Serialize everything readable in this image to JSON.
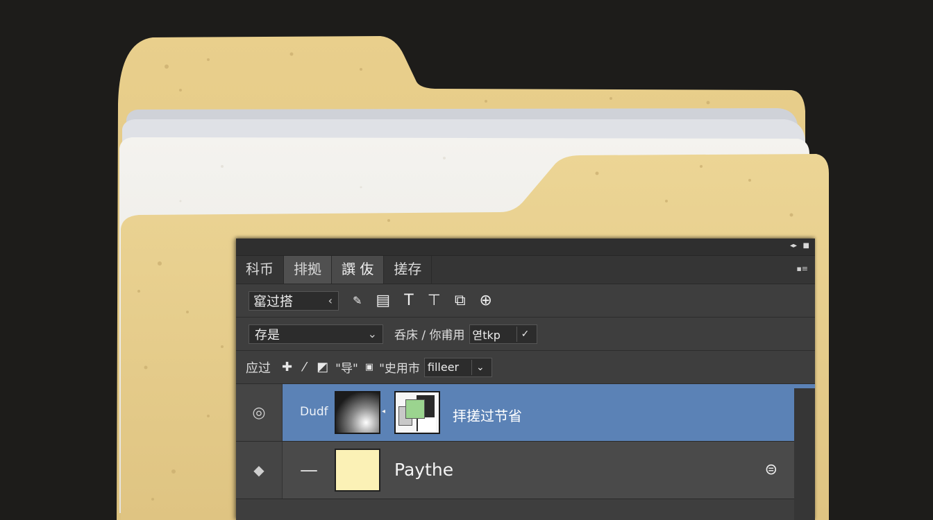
{
  "panel": {
    "titlebar": {
      "collapse_icon": "double-arrow-icon",
      "close_icon": "close-icon"
    },
    "tabs": [
      {
        "label": "科币"
      },
      {
        "label": "排拠"
      },
      {
        "label": "譔 伖"
      },
      {
        "label": "搓存"
      }
    ],
    "menu_icon": "panel-menu-icon"
  },
  "toolbar": {
    "filter_value": "窰过搭",
    "filter_chevron": "‹",
    "icons": [
      "brush-icon",
      "image-filter-icon",
      "text-filter-icon",
      "shape-filter-icon",
      "smart-object-filter-icon",
      "adjustment-filter-icon"
    ]
  },
  "blend": {
    "mode_value": "存是",
    "opacity_label": "呑床 / 你甫用",
    "opacity_value": "엳tkp"
  },
  "lock": {
    "label": "应过",
    "lock_text_a": "\"导\"",
    "fill_label": "\"史用市",
    "fill_value": "filleer"
  },
  "layers": [
    {
      "small_label": "Dudf",
      "title": "拝搓过节省",
      "selected": true
    },
    {
      "title": "Paythe",
      "selected": false
    }
  ]
}
